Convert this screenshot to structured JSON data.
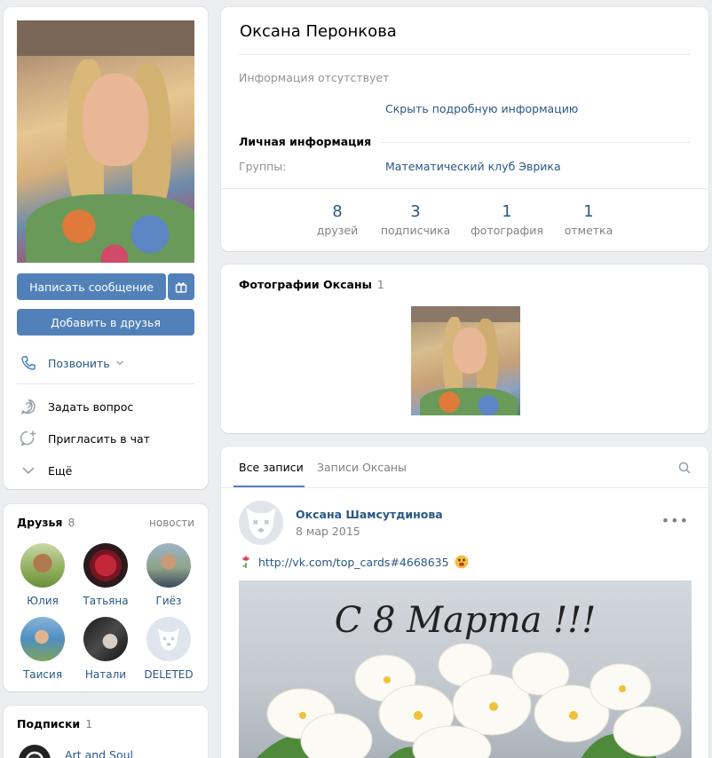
{
  "profile": {
    "buttons": {
      "message": "Написать сообщение",
      "add_friend": "Добавить в друзья"
    },
    "call": "Позвонить",
    "actions": [
      "Задать вопрос",
      "Пригласить в чат",
      "Ещё"
    ]
  },
  "friends": {
    "title": "Друзья",
    "count": "8",
    "news": "новости",
    "items": [
      {
        "name": "Юлия"
      },
      {
        "name": "Татьяна"
      },
      {
        "name": "Гиёз"
      },
      {
        "name": "Таисия"
      },
      {
        "name": "Натали"
      },
      {
        "name": "DELETED"
      }
    ]
  },
  "subscriptions": {
    "title": "Подписки",
    "count": "1",
    "first": "Art and Soul"
  },
  "info": {
    "name": "Оксана Перонкова",
    "no_info": "Информация отсутствует",
    "hide_details": "Скрыть подробную информацию",
    "personal_header": "Личная информация",
    "groups_label": "Группы:",
    "groups_value": "Математический клуб Эврика",
    "counters": [
      {
        "n": "8",
        "label": "друзей"
      },
      {
        "n": "3",
        "label": "подписчика"
      },
      {
        "n": "1",
        "label": "фотография"
      },
      {
        "n": "1",
        "label": "отметка"
      }
    ]
  },
  "photos": {
    "title": "Фотографии Оксаны",
    "count": "1"
  },
  "wall": {
    "tabs": [
      "Все записи",
      "Записи Оксаны"
    ],
    "post": {
      "author": "Оксана Шамсутдинова",
      "date": "8 мар 2015",
      "link": "http://vk.com/top_cards#4668635",
      "image_text": "С 8 Марта !!!"
    }
  },
  "colors": {
    "accent": "#5181b8",
    "link": "#2a5885",
    "bg": "#edeef0"
  },
  "icons": [
    "gift-icon",
    "phone-icon",
    "chevron-down-icon",
    "question-icon",
    "chat-plus-icon",
    "more-chevron-icon",
    "search-icon",
    "more-dots-icon",
    "rose-icon",
    "emoji-icon",
    "deleted-dog-icon"
  ]
}
